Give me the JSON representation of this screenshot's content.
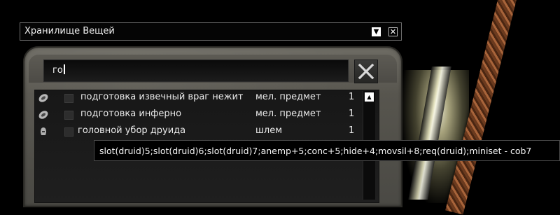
{
  "window": {
    "title": "Хранилище Вещей",
    "dropdown_icon": "▼",
    "close_icon": "✕"
  },
  "search": {
    "value": "го"
  },
  "items": [
    {
      "icon": "ring-icon",
      "name": "подготовка извечный враг нежит",
      "type": "мел. предмет",
      "qty": "1"
    },
    {
      "icon": "ring-icon",
      "name": "подготовка инферно",
      "type": "мел. предмет",
      "qty": "1"
    },
    {
      "icon": "helmet-icon",
      "name": "головной убор друида",
      "type": "шлем",
      "qty": "1"
    }
  ],
  "scrollbar": {
    "up_icon": "▲"
  },
  "tooltip": {
    "text": "slot(druid)5;slot(druid)6;slot(druid)7;anemp+5;conc+5;hide+4;movsil+8;req(druid);miniset - cob7"
  }
}
